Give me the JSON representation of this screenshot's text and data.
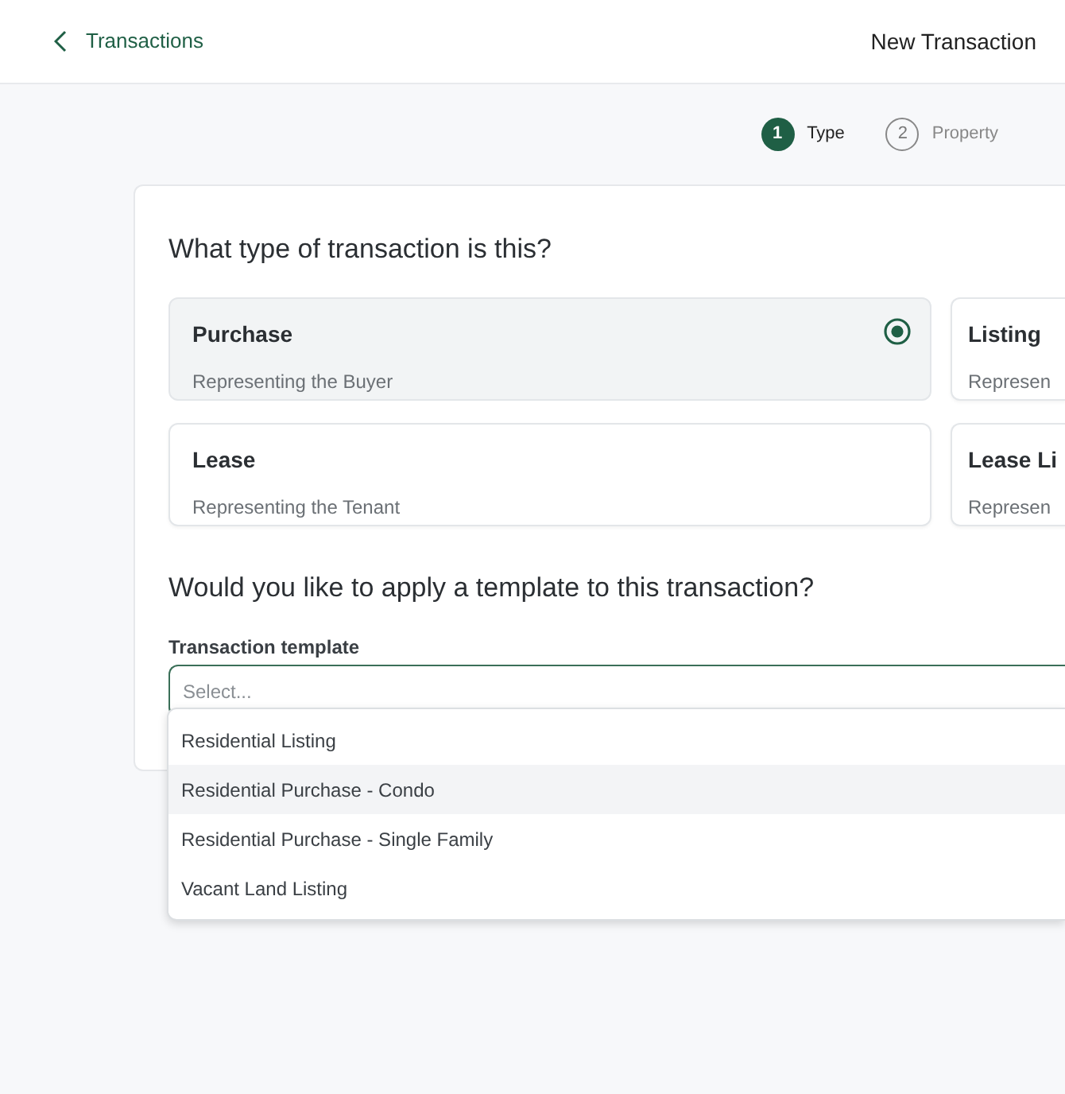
{
  "header": {
    "back_link": "Transactions",
    "title": "New Transaction"
  },
  "steps": [
    {
      "number": "1",
      "label": "Type",
      "active": true
    },
    {
      "number": "2",
      "label": "Property",
      "active": false
    }
  ],
  "question": "What type of transaction is this?",
  "options": [
    {
      "title": "Purchase",
      "subtitle": "Representing the Buyer",
      "selected": true
    },
    {
      "title": "Listing",
      "subtitle": "Represen",
      "selected": false
    },
    {
      "title": "Lease",
      "subtitle": "Representing the Tenant",
      "selected": false
    },
    {
      "title": "Lease Li",
      "subtitle": "Represen",
      "selected": false
    }
  ],
  "template_question": "Would you like to apply a template to this transaction?",
  "template_field": {
    "label": "Transaction template",
    "placeholder": "Select..."
  },
  "template_options": [
    {
      "label": "Residential Listing",
      "highlighted": false
    },
    {
      "label": "Residential Purchase - Condo",
      "highlighted": true
    },
    {
      "label": "Residential Purchase - Single Family",
      "highlighted": false
    },
    {
      "label": "Vacant Land Listing",
      "highlighted": false
    }
  ]
}
